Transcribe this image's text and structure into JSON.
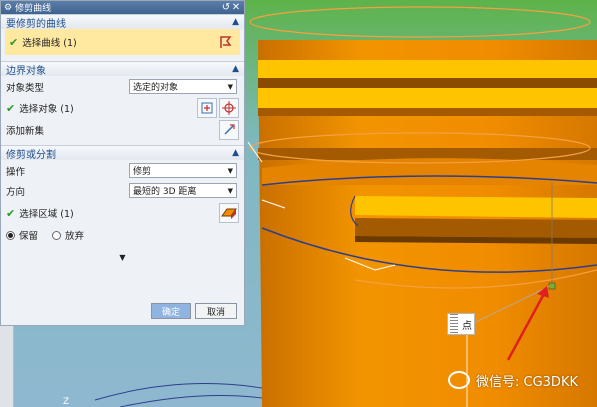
{
  "dialog": {
    "title": "修剪曲线",
    "title_buttons": [
      "↺",
      "✕"
    ],
    "sections": {
      "curve": {
        "header": "要修剪的曲线",
        "select_label": "选择曲线 (1)"
      },
      "boundary": {
        "header": "边界对象",
        "type_label": "对象类型",
        "type_value": "选定的对象",
        "select_label": "选择对象 (1)",
        "add_set_label": "添加新集"
      },
      "trim": {
        "header": "修剪或分割",
        "operation_label": "操作",
        "operation_value": "修剪",
        "direction_label": "方向",
        "direction_value": "最短的 3D 距离",
        "region_label": "选择区域 (1)",
        "keep_label": "保留",
        "discard_label": "放弃",
        "keep_selected": true
      }
    },
    "ok_label": "确定",
    "cancel_label": "取消"
  },
  "viewport": {
    "point_label": "点",
    "axis_label": "Z",
    "watermark": "微信号: CG3DKK"
  },
  "colors": {
    "body_orange": "#f08c00",
    "face_yellow": "#ffc400",
    "background": "#7fb0c9",
    "arrow_red": "#e02020",
    "curve_blue": "#2d3f8c",
    "accent_blue": "#1f4e8c"
  }
}
